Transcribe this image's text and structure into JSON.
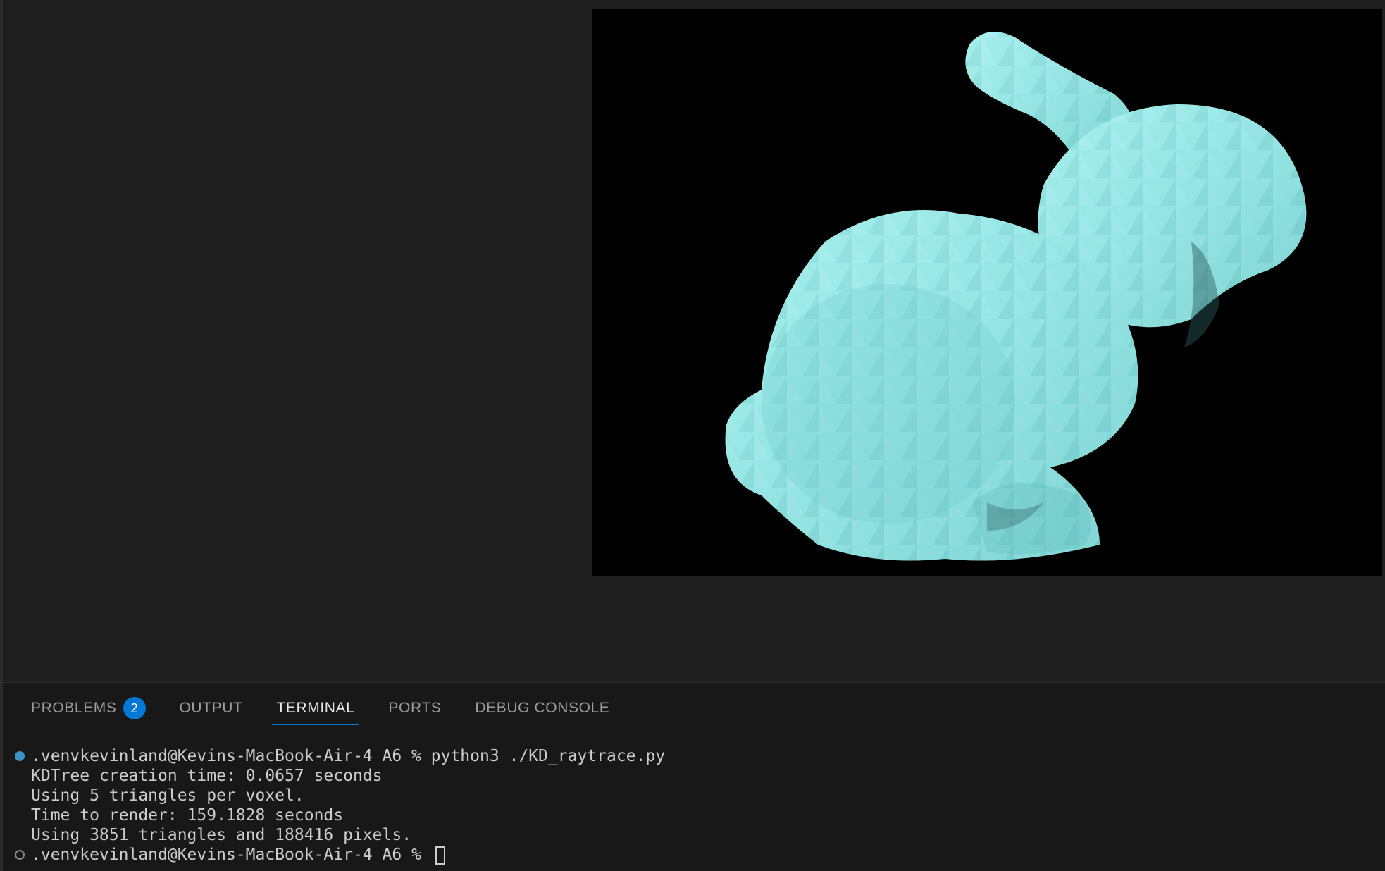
{
  "panel": {
    "tabs": [
      {
        "label": "PROBLEMS",
        "badge": "2"
      },
      {
        "label": "OUTPUT"
      },
      {
        "label": "TERMINAL"
      },
      {
        "label": "PORTS"
      },
      {
        "label": "DEBUG CONSOLE"
      }
    ],
    "active_tab": "TERMINAL"
  },
  "terminal": {
    "lines": [
      ".venvkevinland@Kevins-MacBook-Air-4 A6 % python3 ./KD_raytrace.py",
      "KDTree creation time: 0.0657 seconds",
      "Using 5 triangles per voxel.",
      "Time to render: 159.1828 seconds",
      "Using 3851 triangles and 188416 pixels.",
      ".venvkevinland@Kevins-MacBook-Air-4 A6 % "
    ]
  },
  "render": {
    "subject": "ray-traced bunny mesh",
    "background_color": "#000000",
    "mesh_color": "#8fe3e3"
  },
  "colors": {
    "editor_bg": "#1f1f1f",
    "panel_bg": "#181818",
    "accent": "#0078d4"
  }
}
